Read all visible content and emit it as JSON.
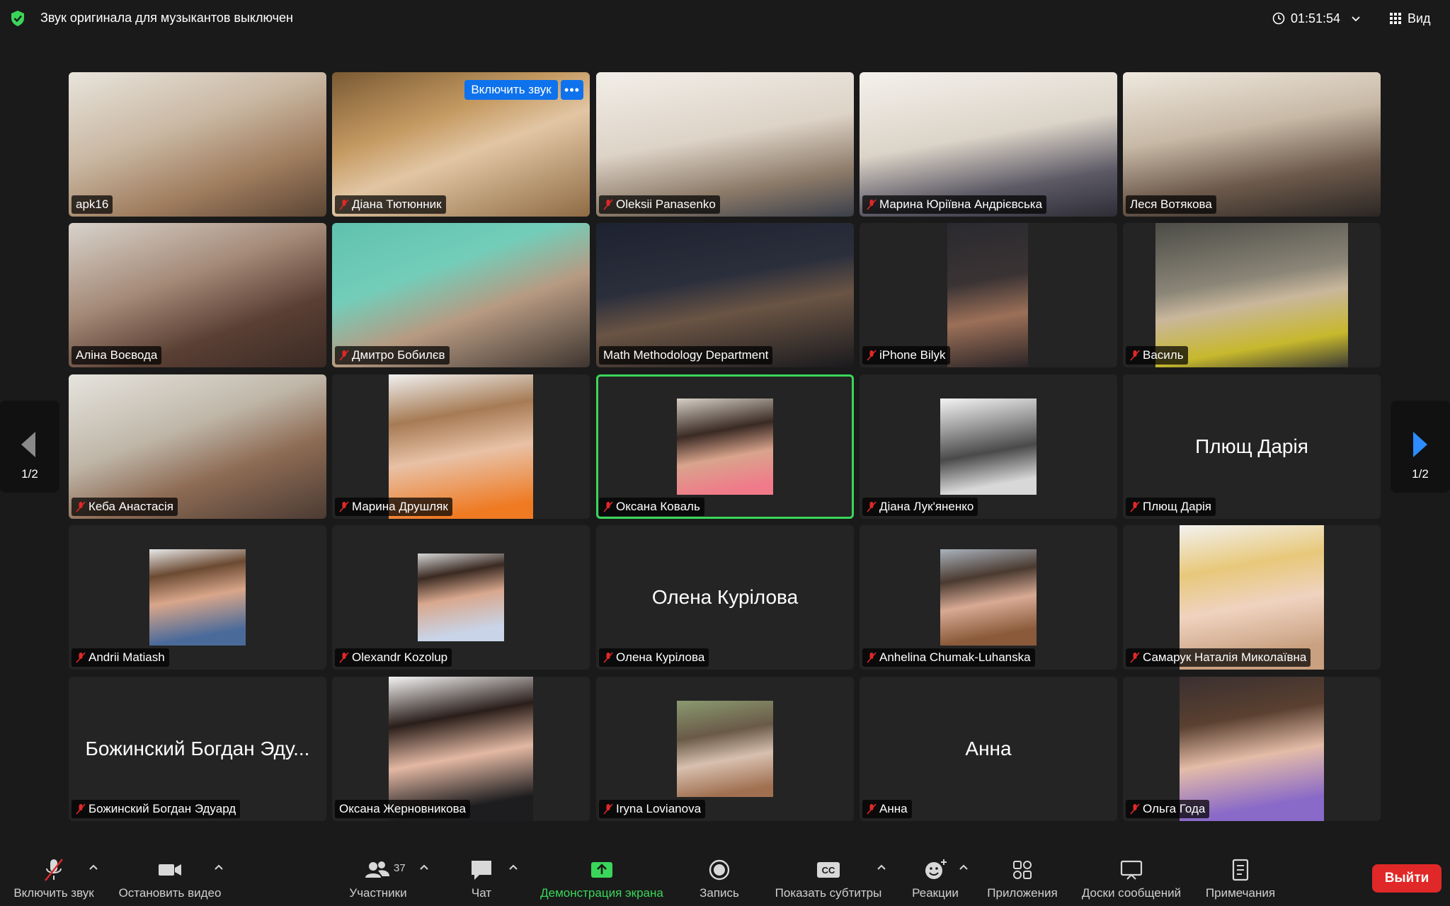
{
  "topbar": {
    "title": "Звук оригинала для музыкантов выключен",
    "timer": "01:51:54",
    "view_label": "Вид"
  },
  "colors": {
    "accent_blue": "#0e72ed",
    "active_speaker": "#3ad65a",
    "muted_red": "#e02828",
    "share_green": "#3ad65a"
  },
  "unmute_button": "Включить звук",
  "more_button": "•••",
  "paging": {
    "left": "1/2",
    "right": "1/2"
  },
  "participants": [
    {
      "name": "apk16",
      "muted": false,
      "display": "video"
    },
    {
      "name": "Діана Тютюнник",
      "muted": true,
      "display": "video"
    },
    {
      "name": "Oleksii Panasenko",
      "muted": true,
      "display": "video"
    },
    {
      "name": "Марина Юріївна  Андрієвська",
      "muted": true,
      "display": "video"
    },
    {
      "name": "Леся Вотякова",
      "muted": false,
      "display": "video"
    },
    {
      "name": "Аліна Воєвода",
      "muted": false,
      "display": "video"
    },
    {
      "name": "Дмитро Бобилєв",
      "muted": true,
      "display": "video"
    },
    {
      "name": "Math Methodology Department",
      "muted": false,
      "display": "video"
    },
    {
      "name": "iPhone Bilyk",
      "muted": true,
      "display": "video"
    },
    {
      "name": "Василь",
      "muted": true,
      "display": "video"
    },
    {
      "name": "Кеба Анастасія",
      "muted": true,
      "display": "video"
    },
    {
      "name": "Марина Друшляк",
      "muted": true,
      "display": "photo"
    },
    {
      "name": "Оксана Коваль",
      "muted": true,
      "display": "photo",
      "active": true
    },
    {
      "name": "Діана Лук'яненко",
      "muted": true,
      "display": "photo"
    },
    {
      "name": "Плющ Дарія",
      "muted": true,
      "display": "name",
      "big_name": "Плющ Дарія"
    },
    {
      "name": "Andrii Matiash",
      "muted": true,
      "display": "photo"
    },
    {
      "name": "Olexandr Kozolup",
      "muted": true,
      "display": "photo"
    },
    {
      "name": "Олена Курілова",
      "muted": true,
      "display": "name",
      "big_name": "Олена Курілова"
    },
    {
      "name": "Anhelina Chumak-Luhanska",
      "muted": true,
      "display": "photo"
    },
    {
      "name": "Самарук Наталія Миколаївна",
      "muted": true,
      "display": "photo"
    },
    {
      "name": "Божинский Богдан Эдуард",
      "muted": true,
      "display": "name",
      "big_name": "Божинский Богдан Эду..."
    },
    {
      "name": "Оксана Жерновникова",
      "muted": false,
      "display": "photo"
    },
    {
      "name": "Iryna Lovianova",
      "muted": true,
      "display": "photo"
    },
    {
      "name": "Анна",
      "muted": true,
      "display": "name",
      "big_name": "Анна"
    },
    {
      "name": "Ольга Года",
      "muted": true,
      "display": "photo"
    }
  ],
  "toolbar": {
    "unmute": "Включить звук",
    "stop_video": "Остановить видео",
    "participants": "Участники",
    "participants_count": "37",
    "chat": "Чат",
    "share_screen": "Демонстрация экрана",
    "record": "Запись",
    "captions": "Показать субтитры",
    "reactions": "Реакции",
    "apps": "Приложения",
    "whiteboards": "Доски сообщений",
    "notes": "Примечания",
    "leave": "Выйти"
  }
}
